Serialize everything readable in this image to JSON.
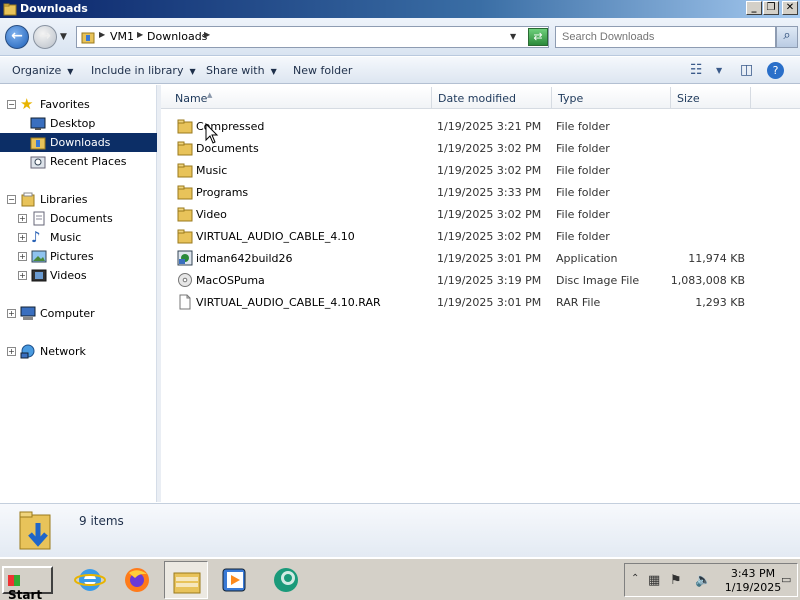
{
  "window": {
    "title": "Downloads"
  },
  "address": {
    "crumbs": [
      "VM1",
      "Downloads"
    ],
    "search_placeholder": "Search Downloads"
  },
  "toolbar": {
    "organize": "Organize",
    "include_in_library": "Include in library",
    "share_with": "Share with",
    "new_folder": "New folder"
  },
  "nav": {
    "favorites": "Favorites",
    "desktop": "Desktop",
    "downloads": "Downloads",
    "recent_places": "Recent Places",
    "libraries": "Libraries",
    "documents": "Documents",
    "music": "Music",
    "pictures": "Pictures",
    "videos": "Videos",
    "computer": "Computer",
    "network": "Network"
  },
  "columns": {
    "name": "Name",
    "date": "Date modified",
    "type": "Type",
    "size": "Size"
  },
  "files": [
    {
      "name": "Compressed",
      "date": "1/19/2025 3:21 PM",
      "type": "File folder",
      "size": "",
      "icon": "folder-icon"
    },
    {
      "name": "Documents",
      "date": "1/19/2025 3:02 PM",
      "type": "File folder",
      "size": "",
      "icon": "folder-icon"
    },
    {
      "name": "Music",
      "date": "1/19/2025 3:02 PM",
      "type": "File folder",
      "size": "",
      "icon": "folder-icon"
    },
    {
      "name": "Programs",
      "date": "1/19/2025 3:33 PM",
      "type": "File folder",
      "size": "",
      "icon": "folder-icon"
    },
    {
      "name": "Video",
      "date": "1/19/2025 3:02 PM",
      "type": "File folder",
      "size": "",
      "icon": "folder-icon"
    },
    {
      "name": "VIRTUAL_AUDIO_CABLE_4.10",
      "date": "1/19/2025 3:02 PM",
      "type": "File folder",
      "size": "",
      "icon": "folder-icon"
    },
    {
      "name": "idman642build26",
      "date": "1/19/2025 3:01 PM",
      "type": "Application",
      "size": "11,974 KB",
      "icon": "application-icon"
    },
    {
      "name": "MacOSPuma",
      "date": "1/19/2025 3:19 PM",
      "type": "Disc Image File",
      "size": "1,083,008 KB",
      "icon": "disc-image-icon"
    },
    {
      "name": "VIRTUAL_AUDIO_CABLE_4.10.RAR",
      "date": "1/19/2025 3:01 PM",
      "type": "RAR File",
      "size": "1,293 KB",
      "icon": "rar-file-icon"
    }
  ],
  "details": {
    "item_count": "9 items"
  },
  "taskbar": {
    "start": "Start",
    "time": "3:43 PM",
    "date": "1/19/2025"
  }
}
